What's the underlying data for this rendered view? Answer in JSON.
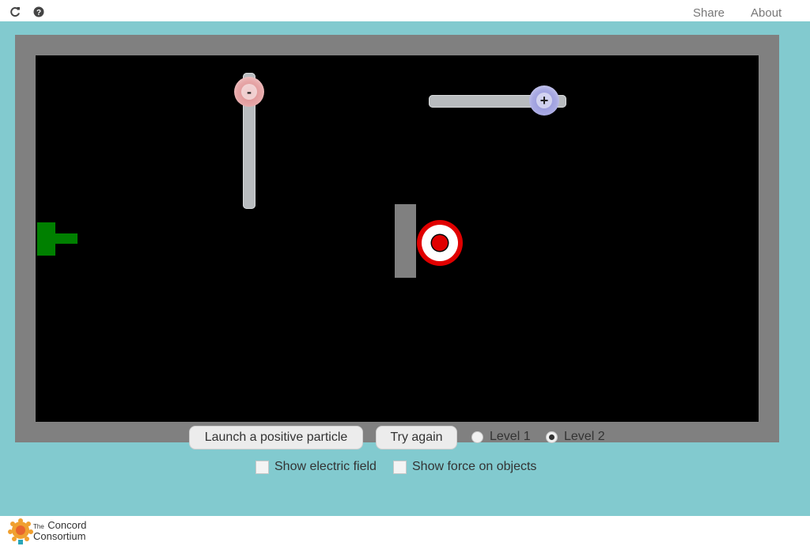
{
  "topbar": {
    "icons": [
      "refresh-icon",
      "help-icon"
    ],
    "share_label": "Share",
    "about_label": "About"
  },
  "simulation": {
    "negative_charge_sign": "-",
    "positive_charge_sign": "+",
    "colors": {
      "frame": "#808080",
      "field": "#000000",
      "launcher": "#008000",
      "target_ring": "#e00000",
      "background": "#82cacf"
    }
  },
  "controls": {
    "launch_label": "Launch a positive particle",
    "try_again_label": "Try again",
    "levels": [
      {
        "label": "Level 1",
        "selected": false
      },
      {
        "label": "Level 2",
        "selected": true
      }
    ],
    "show_field_label": "Show electric field",
    "show_force_label": "Show force on objects"
  },
  "footer": {
    "logo_the": "The",
    "logo_concord": "Concord",
    "logo_consortium": "Consortium"
  }
}
